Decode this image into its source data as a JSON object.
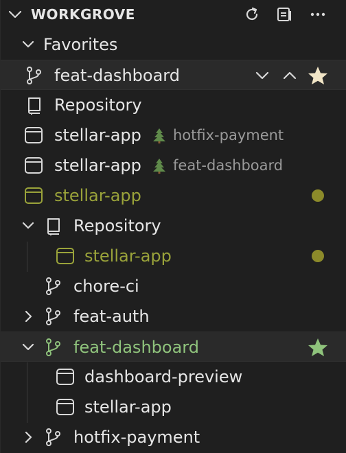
{
  "header": {
    "title": "WORKGROVE"
  },
  "favorites": {
    "label": "Favorites",
    "items": [
      {
        "label": "feat-dashboard"
      },
      {
        "label": "Repository"
      },
      {
        "label": "stellar-app",
        "sub": "hotfix-payment"
      },
      {
        "label": "stellar-app",
        "sub": "feat-dashboard"
      },
      {
        "label": "stellar-app"
      }
    ]
  },
  "repo": {
    "label": "Repository",
    "children": [
      {
        "label": "stellar-app"
      }
    ]
  },
  "branches": [
    {
      "label": "chore-ci"
    },
    {
      "label": "feat-auth"
    },
    {
      "label": "feat-dashboard"
    },
    {
      "label": "hotfix-payment"
    }
  ],
  "dashboard_children": [
    {
      "label": "dashboard-preview"
    },
    {
      "label": "stellar-app"
    }
  ],
  "colors": {
    "background": "#1f1f1f",
    "modified": "#8c8a2a",
    "branch_active": "#8fc37c",
    "star_favorite": "#f2e6c7",
    "star_active": "#8fc37c"
  }
}
